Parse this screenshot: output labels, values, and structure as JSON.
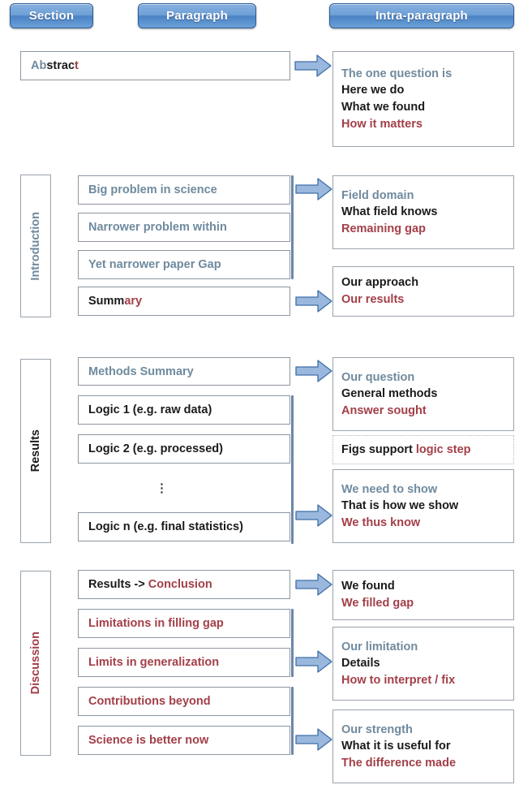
{
  "headers": [
    {
      "id": "section",
      "label": "Section"
    },
    {
      "id": "paragraph",
      "label": "Paragraph"
    },
    {
      "id": "intra",
      "label": "Intra-paragraph"
    }
  ],
  "colors": {
    "blue_text": "#6f8a9e",
    "black_text": "#1a1a1a",
    "red_text": "#a33f48",
    "pill_blue": "#4b82c4",
    "arrow_fill": "#9ab8dd",
    "arrow_stroke": "#3f6ea8",
    "connector": "#6b87a8",
    "box_border": "#9aa3ac"
  },
  "sections": [
    {
      "id": "abstract",
      "label": ""
    },
    {
      "id": "introduction",
      "label": "Introduction",
      "label_color": "blue"
    },
    {
      "id": "results",
      "label": "Results",
      "label_color": "black"
    },
    {
      "id": "discussion",
      "label": "Discussion",
      "label_color": "red"
    }
  ],
  "paragraphs": {
    "abstract": {
      "text": "Abstract",
      "parts": [
        "Ab",
        "strac",
        "t"
      ]
    },
    "big_problem": {
      "text": "Big problem in science"
    },
    "narrower": {
      "text": "Narrower problem within"
    },
    "yet_narrower": {
      "text": "Yet narrower paper Gap"
    },
    "summary": {
      "text": "Summary",
      "parts": [
        "Summ",
        "ary"
      ]
    },
    "methods": {
      "text": "Methods Summary"
    },
    "logic1": {
      "text": "Logic 1 (e.g. raw data)"
    },
    "logic2": {
      "text": "Logic 2 (e.g. processed)"
    },
    "ellipsis": {
      "text": "⋮"
    },
    "logicn": {
      "text": "Logic n (e.g. final statistics)"
    },
    "results_concl": {
      "text": "Results -> Conclusion",
      "parts": [
        "Results -> ",
        "Conclusion"
      ]
    },
    "limitations": {
      "text": "Limitations in filling gap"
    },
    "limits_gen": {
      "text": "Limits in generalization"
    },
    "contributions": {
      "text": "Contributions beyond"
    },
    "science_better": {
      "text": "Science is better now"
    }
  },
  "intra": {
    "abstract": {
      "lines": [
        {
          "text": "The one question is",
          "color": "blue"
        },
        {
          "text": "Here we do",
          "color": "black"
        },
        {
          "text": "What we found",
          "color": "black"
        },
        {
          "text": "How it matters",
          "color": "red"
        }
      ]
    },
    "intro_gap": {
      "lines": [
        {
          "text": "Field domain",
          "color": "blue"
        },
        {
          "text": "What field knows",
          "color": "black"
        },
        {
          "text": "Remaining gap",
          "color": "red"
        }
      ]
    },
    "intro_summary": {
      "lines": [
        {
          "text": "Our approach",
          "color": "black"
        },
        {
          "text": "Our results",
          "color": "red"
        }
      ]
    },
    "results_methods": {
      "lines": [
        {
          "text": "Our question",
          "color": "blue"
        },
        {
          "text": "General methods",
          "color": "black"
        },
        {
          "text": "Answer sought",
          "color": "red"
        }
      ]
    },
    "results_figs": {
      "parts": [
        {
          "text": "Figs support ",
          "color": "black"
        },
        {
          "text": "logic step",
          "color": "red"
        }
      ]
    },
    "results_logic": {
      "lines": [
        {
          "text": "We need to show",
          "color": "blue"
        },
        {
          "text": "That is how we show",
          "color": "black"
        },
        {
          "text": "We thus know",
          "color": "red"
        }
      ]
    },
    "disc_conclusion": {
      "lines": [
        {
          "text": "We found",
          "color": "black"
        },
        {
          "text": "We filled gap",
          "color": "red"
        }
      ]
    },
    "disc_limitation": {
      "lines": [
        {
          "text": "Our limitation",
          "color": "blue"
        },
        {
          "text": "Details",
          "color": "black"
        },
        {
          "text": "How to interpret / fix",
          "color": "red"
        }
      ]
    },
    "disc_strength": {
      "lines": [
        {
          "text": "Our strength",
          "color": "blue"
        },
        {
          "text": "What it is useful for",
          "color": "black"
        },
        {
          "text": "The difference made",
          "color": "red"
        }
      ]
    }
  },
  "arrows": [
    {
      "id": "arrow-abstract"
    },
    {
      "id": "arrow-intro-gap"
    },
    {
      "id": "arrow-intro-summary"
    },
    {
      "id": "arrow-results-methods"
    },
    {
      "id": "arrow-results-logic"
    },
    {
      "id": "arrow-disc-conclusion"
    },
    {
      "id": "arrow-disc-limitation"
    },
    {
      "id": "arrow-disc-strength"
    }
  ]
}
